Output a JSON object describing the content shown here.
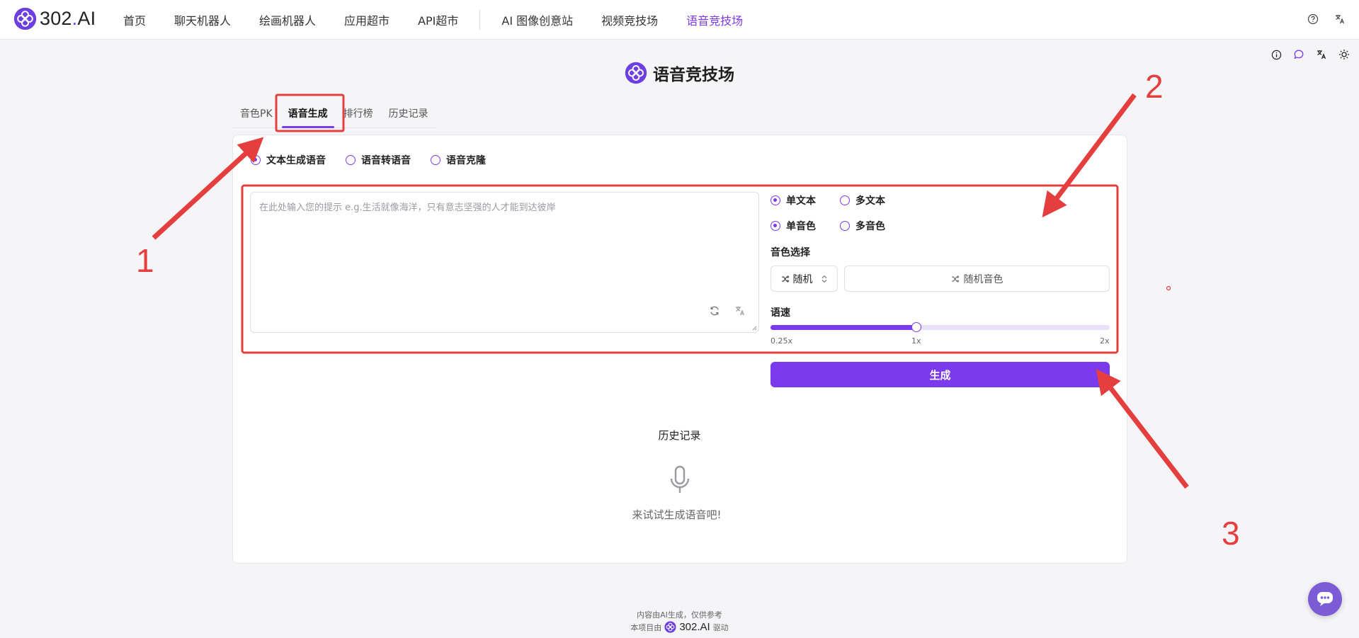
{
  "nav": {
    "logo_text": "302",
    "logo_dot": ".",
    "logo_suffix": "AI",
    "items": [
      {
        "label": "首页"
      },
      {
        "label": "聊天机器人"
      },
      {
        "label": "绘画机器人"
      },
      {
        "label": "应用超市"
      },
      {
        "label": "API超市"
      },
      {
        "label": "AI 图像创意站"
      },
      {
        "label": "视频竞技场"
      },
      {
        "label": "语音竞技场"
      }
    ],
    "right_icons": [
      "help-icon",
      "translate-icon"
    ]
  },
  "toolbar_icons": [
    "info-icon",
    "chat-bubble-icon",
    "translate-icon",
    "sun-icon"
  ],
  "page": {
    "title": "语音竞技场"
  },
  "tabs": [
    "音色PK",
    "语音生成",
    "排行榜",
    "历史记录"
  ],
  "active_tab": "语音生成",
  "modes": [
    {
      "label": "文本生成语音",
      "checked": true
    },
    {
      "label": "语音转语音",
      "checked": false
    },
    {
      "label": "语音克隆",
      "checked": false
    }
  ],
  "prompt": {
    "placeholder": "在此处输入您的提示 e.g.生活就像海洋，只有意志坚强的人才能到达彼岸",
    "value": ""
  },
  "text_mode": [
    {
      "label": "单文本",
      "checked": true
    },
    {
      "label": "多文本",
      "checked": false
    }
  ],
  "voice_mode": [
    {
      "label": "单音色",
      "checked": true
    },
    {
      "label": "多音色",
      "checked": false
    }
  ],
  "voice_select": {
    "label": "音色选择",
    "selected": "随机",
    "random_voice_label": "随机音色"
  },
  "speed": {
    "label": "语速",
    "min_label": "0.25x",
    "mid_label": "1x",
    "max_label": "2x",
    "value": 1,
    "min": 0.25,
    "max": 2,
    "fill_fraction": 0.43
  },
  "generate_label": "生成",
  "history": {
    "title": "历史记录",
    "empty_text": "来试试生成语音吧!"
  },
  "footer": {
    "line1": "内容由AI生成，仅供参考",
    "line2_prefix": "本项目由",
    "brand": "302.AI",
    "line2_suffix": "驱动"
  },
  "annotations": [
    "1",
    "2",
    "3"
  ],
  "colors": {
    "accent": "#7c3aed",
    "annotation_red": "#e53e3e",
    "fab": "#7b5cd6"
  }
}
